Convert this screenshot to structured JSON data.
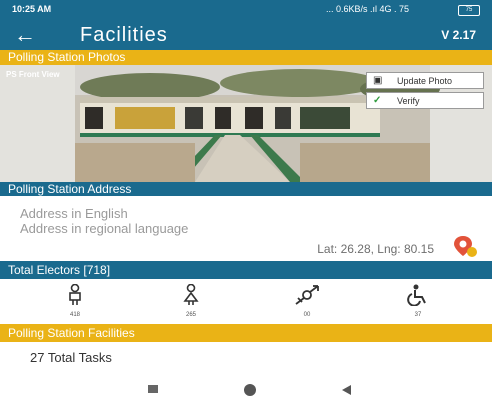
{
  "status_bar": {
    "time": "10:25 AM",
    "network": "... 0.6KB/s .ıl 4G . 75",
    "battery": "75"
  },
  "app_bar": {
    "title": "Facilities",
    "version": "V 2.17"
  },
  "sections": {
    "photos_header": "Polling Station Photos",
    "address_header": "Polling Station Address",
    "electors_header": "Total Electors [718]",
    "facilities_header": "Polling Station Facilities"
  },
  "photo": {
    "label": "PS Front View",
    "update_button": "Update Photo",
    "verify_button": "Verify"
  },
  "address": {
    "english_placeholder": "Address in English",
    "regional_placeholder": "Address in regional language",
    "coordinates": "Lat: 26.28, Lng: 80.15"
  },
  "electors": [
    {
      "type": "male",
      "icon": "male-icon",
      "value": "418"
    },
    {
      "type": "female",
      "icon": "female-icon",
      "value": "265"
    },
    {
      "type": "third-gender",
      "icon": "third-gender-icon",
      "value": "00"
    },
    {
      "type": "pwd",
      "icon": "wheelchair-icon",
      "value": "37"
    }
  ],
  "facilities": {
    "total_tasks": "27 Total Tasks"
  },
  "colors": {
    "primary": "#1a6a8e",
    "accent": "#eab316",
    "location": "#e2533a"
  }
}
